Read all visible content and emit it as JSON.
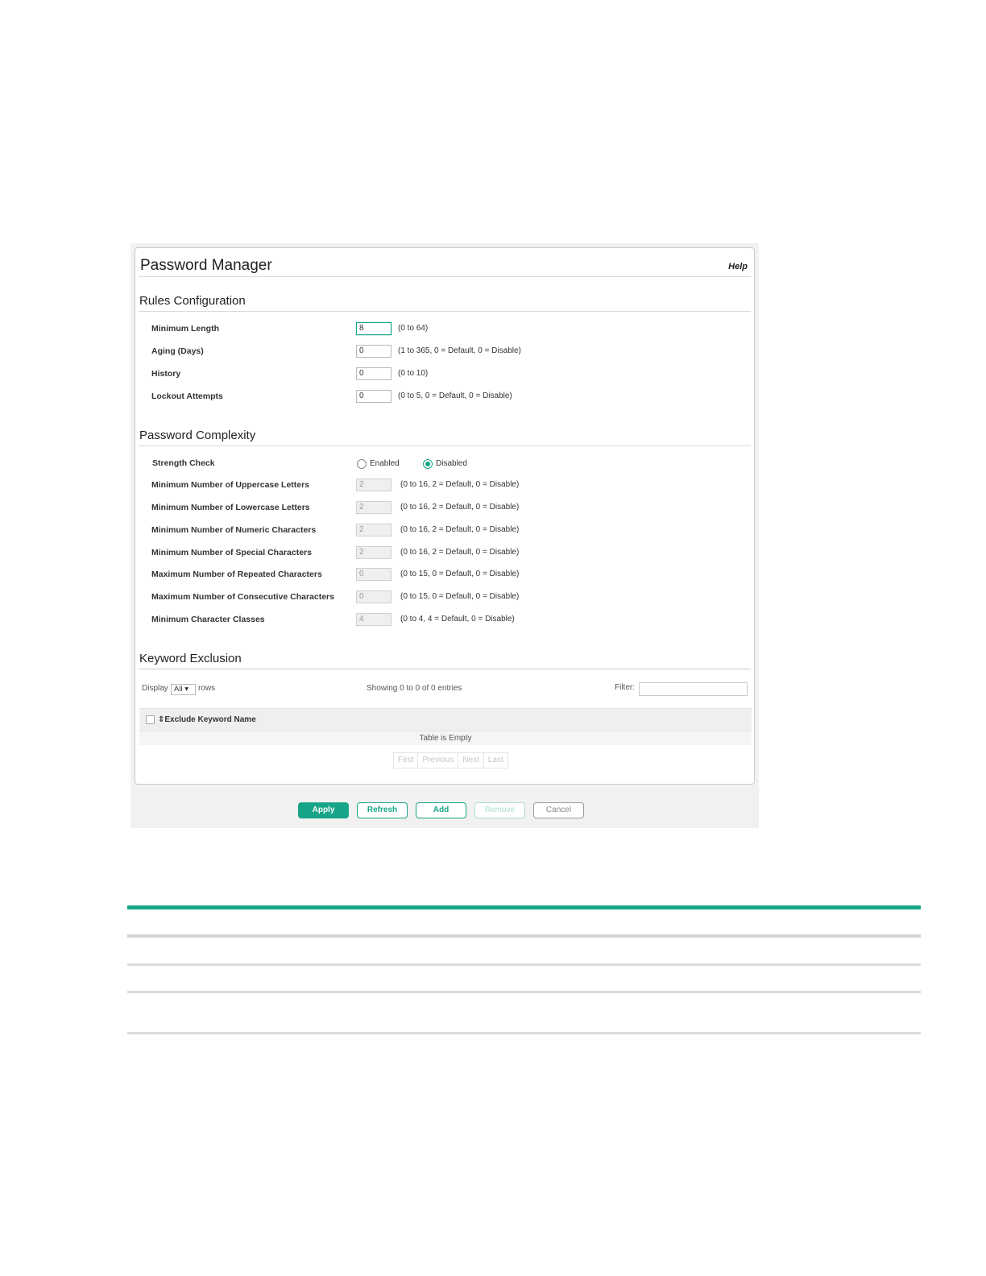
{
  "panel": {
    "title": "Password Manager",
    "help": "Help"
  },
  "rules": {
    "heading": "Rules Configuration",
    "rows": [
      {
        "label": "Minimum Length",
        "value": "8",
        "hint": "(0 to 64)"
      },
      {
        "label": "Aging  (Days)",
        "value": "0",
        "hint": "(1 to 365, 0 = Default, 0 = Disable)"
      },
      {
        "label": "History",
        "value": "0",
        "hint": "(0 to 10)"
      },
      {
        "label": "Lockout Attempts",
        "value": "0",
        "hint": "(0 to 5, 0 = Default, 0 = Disable)"
      }
    ]
  },
  "complexity": {
    "heading": "Password Complexity",
    "strength_label": "Strength Check",
    "enabled_label": "Enabled",
    "disabled_label": "Disabled",
    "selected": "Disabled",
    "rows": [
      {
        "label": "Minimum Number of Uppercase Letters",
        "value": "2",
        "hint": "(0 to 16, 2 = Default, 0 = Disable)"
      },
      {
        "label": "Minimum Number of Lowercase Letters",
        "value": "2",
        "hint": "(0 to 16, 2 = Default, 0 = Disable)"
      },
      {
        "label": "Minimum Number of Numeric Characters",
        "value": "2",
        "hint": "(0 to 16, 2 = Default, 0 = Disable)"
      },
      {
        "label": "Minimum Number of Special Characters",
        "value": "2",
        "hint": "(0 to 16, 2 = Default, 0 = Disable)"
      },
      {
        "label": "Maximum Number of Repeated Characters",
        "value": "0",
        "hint": "(0 to 15, 0 = Default, 0 = Disable)"
      },
      {
        "label": "Maximum Number of Consecutive Characters",
        "value": "0",
        "hint": "(0 to 15, 0 = Default, 0 = Disable)"
      },
      {
        "label": "Minimum Character Classes",
        "value": "4",
        "hint": "(0 to 4, 4 = Default, 0 = Disable)"
      }
    ]
  },
  "keyword": {
    "heading": "Keyword Exclusion",
    "display_label": "Display",
    "display_value": "All ▾",
    "rows_label": "rows",
    "showing": "Showing 0 to 0 of 0 entries",
    "filter_label": "Filter:",
    "column": "Exclude Keyword Name",
    "sort_icon": "⇕",
    "empty_text": "Table is Empty",
    "pager": [
      "First",
      "Previous",
      "Next",
      "Last"
    ]
  },
  "buttons": {
    "apply": "Apply",
    "refresh": "Refresh",
    "add": "Add",
    "remove": "Remove",
    "cancel": "Cancel"
  },
  "colors": {
    "accent": "#17a589"
  }
}
